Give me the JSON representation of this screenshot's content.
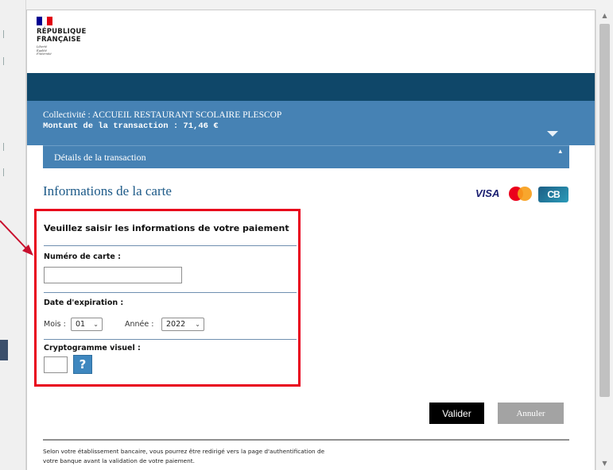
{
  "header": {
    "logo_line1": "RÉPUBLIQUE",
    "logo_line2": "FRANÇAISE",
    "motto": [
      "Liberté",
      "Égalité",
      "Fraternité"
    ],
    "flag_colors": [
      "#000091",
      "#ffffff",
      "#e1000f"
    ]
  },
  "transaction": {
    "collectivite": "Collectivité : ACCUEIL RESTAURANT SCOLAIRE PLESCOP",
    "montant": "Montant de la transaction :  71,46 €",
    "details_label": "Détails de la transaction",
    "details_toggle_icon": "caret-up-icon"
  },
  "card_section": {
    "title": "Informations de la carte",
    "logos": {
      "visa": "VISA",
      "cb": "CB"
    }
  },
  "form": {
    "heading": "Veuillez saisir les informations de votre paiement",
    "card_number_label": "Numéro de carte :",
    "card_number_value": "",
    "expiry_label": "Date d'expiration :",
    "month_label": "Mois :",
    "month_value": "01",
    "year_label": "Année :",
    "year_value": "2022",
    "cvv_label": "Cryptogramme visuel :",
    "cvv_value": "",
    "help_label": "?"
  },
  "buttons": {
    "valider": "Valider",
    "annuler": "Annuler"
  },
  "footer": {
    "line1": "Selon votre établissement bancaire, vous pourrez être redirigé vers la page d'authentification de",
    "line2": "votre banque avant la validation de votre paiement."
  },
  "colors": {
    "navy": "#0f4769",
    "band_blue": "#4682b4",
    "title_blue": "#1d5a88",
    "highlight_red": "#e8001c",
    "valider_bg": "#000000",
    "annuler_bg": "#a3a3a3"
  }
}
